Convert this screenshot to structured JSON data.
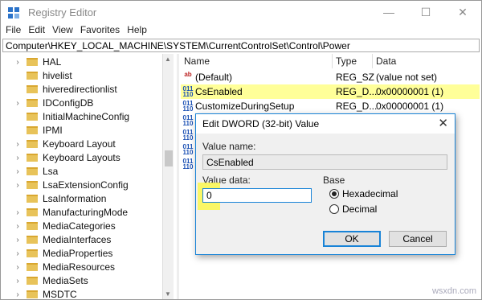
{
  "window": {
    "title": "Registry Editor",
    "minimize_icon": "minimize-icon",
    "maximize_icon": "maximize-icon",
    "close_icon": "close-icon"
  },
  "menu": [
    "File",
    "Edit",
    "View",
    "Favorites",
    "Help"
  ],
  "address": "Computer\\HKEY_LOCAL_MACHINE\\SYSTEM\\CurrentControlSet\\Control\\Power",
  "tree": [
    {
      "label": "HAL",
      "expandable": true
    },
    {
      "label": "hivelist",
      "expandable": false
    },
    {
      "label": "hiveredirectionlist",
      "expandable": false
    },
    {
      "label": "IDConfigDB",
      "expandable": true
    },
    {
      "label": "InitialMachineConfig",
      "expandable": false
    },
    {
      "label": "IPMI",
      "expandable": false
    },
    {
      "label": "Keyboard Layout",
      "expandable": true
    },
    {
      "label": "Keyboard Layouts",
      "expandable": true
    },
    {
      "label": "Lsa",
      "expandable": true
    },
    {
      "label": "LsaExtensionConfig",
      "expandable": true
    },
    {
      "label": "LsaInformation",
      "expandable": false
    },
    {
      "label": "ManufacturingMode",
      "expandable": true
    },
    {
      "label": "MediaCategories",
      "expandable": true
    },
    {
      "label": "MediaInterfaces",
      "expandable": true
    },
    {
      "label": "MediaProperties",
      "expandable": true
    },
    {
      "label": "MediaResources",
      "expandable": true
    },
    {
      "label": "MediaSets",
      "expandable": true
    },
    {
      "label": "MSDTC",
      "expandable": true
    }
  ],
  "values_pane": {
    "columns": {
      "name": "Name",
      "type": "Type",
      "data": "Data"
    },
    "rows": [
      {
        "name": "(Default)",
        "type": "REG_SZ",
        "data": "(value not set)",
        "kind": "string",
        "selected": false
      },
      {
        "name": "CsEnabled",
        "type": "REG_D...",
        "data": "0x00000001 (1)",
        "kind": "dword",
        "selected": true
      },
      {
        "name": "CustomizeDuringSetup",
        "type": "REG_D...",
        "data": "0x00000001 (1)",
        "kind": "dword",
        "selected": false
      }
    ]
  },
  "dialog": {
    "title": "Edit DWORD (32-bit) Value",
    "value_name_label": "Value name:",
    "value_name": "CsEnabled",
    "value_data_label": "Value data:",
    "value_data": "0",
    "base_label": "Base",
    "base_options": [
      {
        "label": "Hexadecimal",
        "selected": true
      },
      {
        "label": "Decimal",
        "selected": false
      }
    ],
    "ok_label": "OK",
    "cancel_label": "Cancel"
  },
  "watermark": "wsxdn.com",
  "colors": {
    "selection_highlight": "#ffff99",
    "annotation_highlight": "#fbf84d",
    "focus_border": "#1883d7"
  }
}
